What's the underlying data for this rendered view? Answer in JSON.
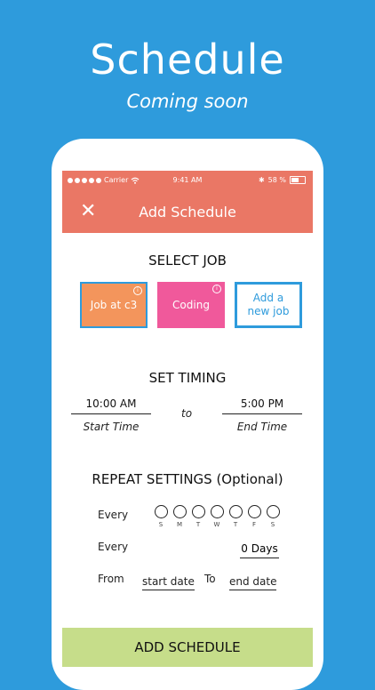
{
  "promo": {
    "title": "Schedule",
    "subtitle": "Coming soon"
  },
  "status": {
    "carrier": "Carrier",
    "time": "9:41 AM",
    "battery": "58 %"
  },
  "nav": {
    "title": "Add Schedule"
  },
  "select_job": {
    "heading": "SELECT JOB",
    "jobs": [
      {
        "label": "Job at c3",
        "color": "#f3955c"
      },
      {
        "label": "Coding",
        "color": "#f0599b"
      },
      {
        "label": "Add a\nnew job",
        "color": "#2e9bdc"
      }
    ]
  },
  "timing": {
    "heading": "SET TIMING",
    "start_value": "10:00 AM",
    "start_caption": "Start Time",
    "to": "to",
    "end_value": "5:00 PM",
    "end_caption": "End Time"
  },
  "repeat": {
    "heading": "REPEAT SETTINGS (Optional)",
    "every_label": "Every",
    "weekdays": [
      "S",
      "M",
      "T",
      "W",
      "T",
      "F",
      "S"
    ],
    "every_label_2": "Every",
    "interval_value": "0 Days",
    "from_label": "From",
    "start_date_placeholder": "start date",
    "to_label": "To",
    "end_date_placeholder": "end date"
  },
  "action": {
    "add_label": "ADD SCHEDULE"
  },
  "colors": {
    "background": "#2e9bdc",
    "header": "#ea7765",
    "add_button": "#c6dd8a"
  }
}
